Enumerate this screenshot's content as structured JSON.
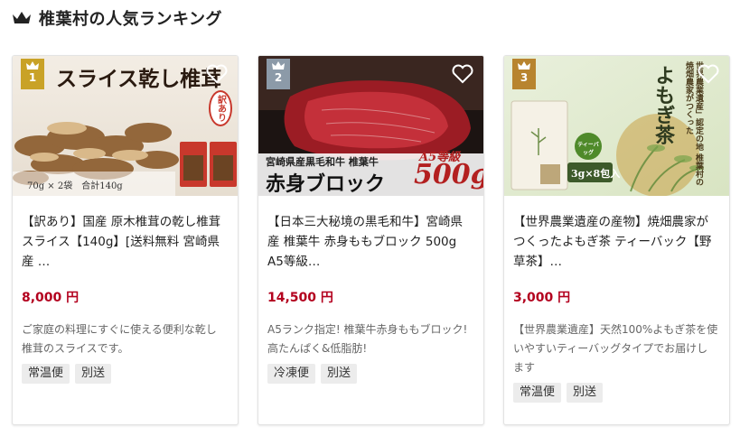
{
  "header": {
    "title": "椎葉村の人気ランキング",
    "icon": "crown-icon"
  },
  "colors": {
    "price": "#b3001e",
    "rank1": "#c9a227",
    "rank2": "#8c9aa8",
    "rank3": "#b8842f"
  },
  "cards": [
    {
      "rank": "1",
      "image": {
        "headline": "スライス乾し椎茸",
        "stamp": "訳あり",
        "caption": "70g × 2袋　合計140g"
      },
      "title": "【訳あり】国産 原木椎茸の乾し椎茸スライス【140g】[送料無料 宮崎県産 …",
      "price": "8,000 円",
      "description": "ご家庭の料理にすぐに使える便利な乾し椎茸のスライスです。",
      "tags": [
        "常温便",
        "別送"
      ]
    },
    {
      "rank": "2",
      "image": {
        "subline": "宮崎県産黒毛和牛 椎葉牛",
        "headline": "赤身ブロック",
        "grade": "A5等級",
        "weight": "500g"
      },
      "title": "【日本三大秘境の黒毛和牛】宮崎県産 椎葉牛 赤身ももブロック 500g A5等級…",
      "price": "14,500 円",
      "description": "A5ランク指定! 椎葉牛赤身ももブロック! 高たんぱく&低脂肪!",
      "tags": [
        "冷凍便",
        "別送"
      ]
    },
    {
      "rank": "3",
      "image": {
        "headline": "よもぎ茶",
        "vertical": "世界農業遺産」認定の地 椎葉村の焼畑農家がつくった",
        "badge": "ティーバッグ",
        "pack": "3g×8包入"
      },
      "title": "【世界農業遺産の産物】焼畑農家がつくったよもぎ茶 ティーバック【野草茶】…",
      "price": "3,000 円",
      "description": "【世界農業遺産】天然100%よもぎ茶を使いやすいティーバッグタイプでお届けします",
      "tags": [
        "常温便",
        "別送"
      ]
    }
  ]
}
